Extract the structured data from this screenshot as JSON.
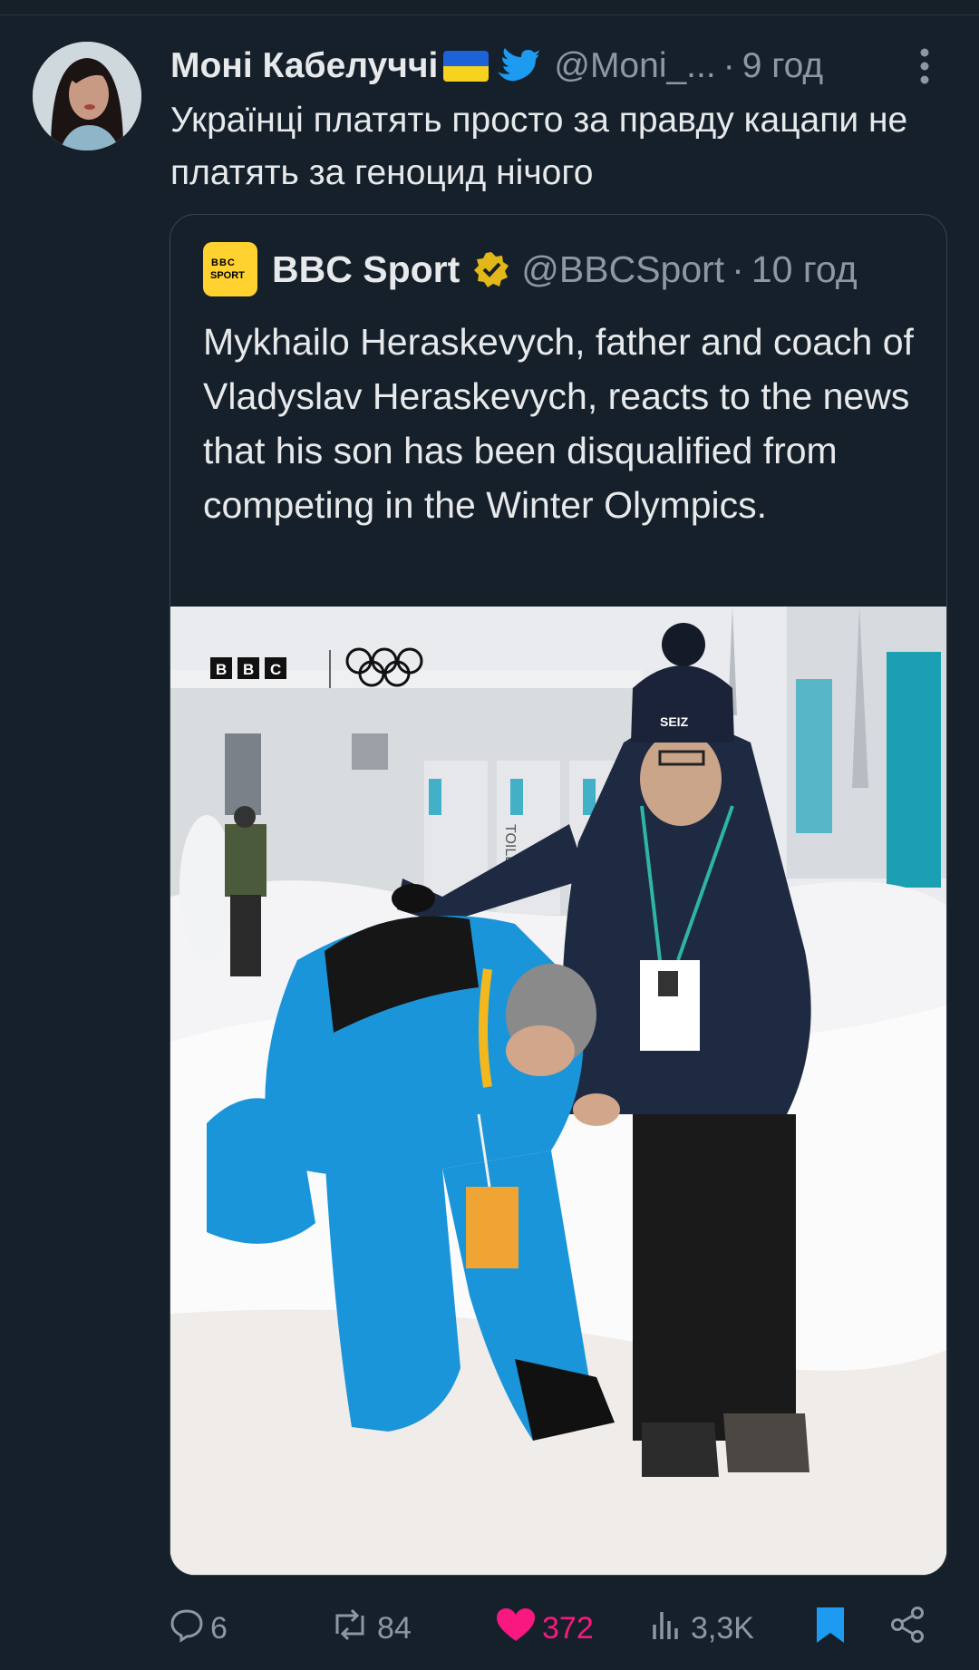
{
  "tweet": {
    "author_name": "Моні Кабелуччі",
    "handle": "@Moni_...",
    "separator": "·",
    "time": "9 год",
    "text": "Українці платять просто  за правду кацапи не платять за геноцид нічого"
  },
  "quote": {
    "name": "BBC Sport",
    "handle": "@BBCSport",
    "separator": "·",
    "time": "10 год",
    "logo_line1": "BBC",
    "logo_line2": "SPORT",
    "text": "Mykhailo Heraskevych, father and coach of Vladyslav Heraskevych, reacts to the news that his son has been disqualified from competing in the Winter Olympics.",
    "photo_overlay": {
      "bbc_letters": [
        "B",
        "B",
        "C"
      ],
      "toilet_sign": "TOILETS",
      "hat_label": "SEIZ"
    }
  },
  "actions": {
    "replies": "6",
    "reposts": "84",
    "likes": "372",
    "views": "3,3K"
  },
  "colors": {
    "background": "#15202b",
    "text": "#e7e9ea",
    "muted": "#8b98a5",
    "like": "#f91880",
    "bookmark": "#1d9bf0",
    "bbc_yellow": "#ffd230"
  },
  "icons": [
    "more-icon",
    "bird-icon",
    "flag-icon",
    "verified-icon",
    "reply-icon",
    "repost-icon",
    "heart-icon",
    "views-icon",
    "bookmark-icon",
    "share-icon"
  ]
}
